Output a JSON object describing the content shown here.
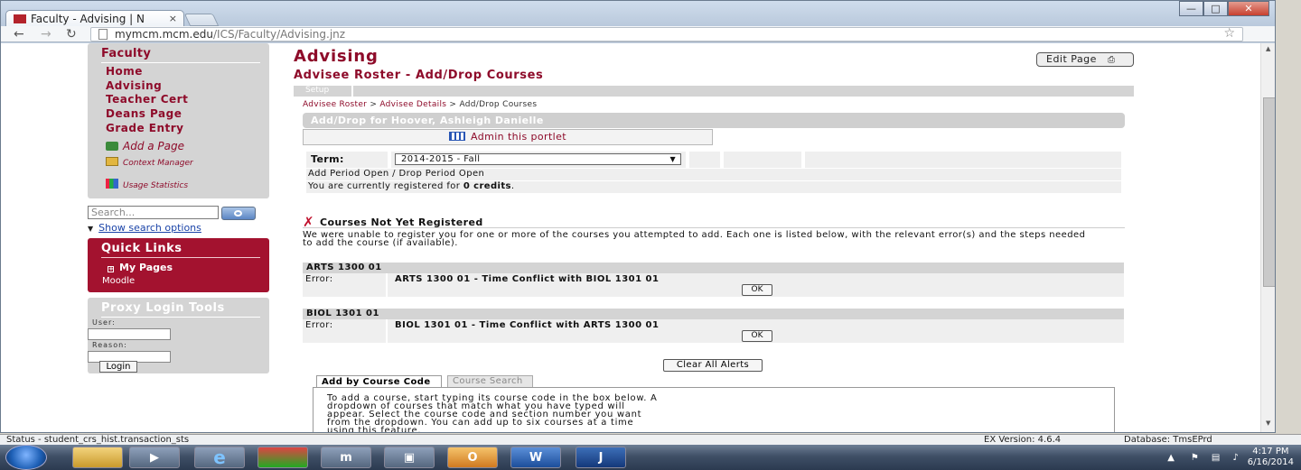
{
  "browser": {
    "tab_title": "Faculty - Advising | N",
    "tab_close": "×",
    "url_host": "mymcm.mcm.edu",
    "url_path": "/ICS/Faculty/Advising.jnz"
  },
  "status": {
    "text": "Status - student_crs_hist.transaction_sts",
    "ex_version": "EX Version: 4.6.4",
    "database": "Database: TmsEPrd"
  },
  "taskbar": {
    "time": "4:17 PM",
    "date": "6/16/2014",
    "word_label": "W",
    "j_label": "J"
  },
  "sidebar": {
    "faculty_title": "Faculty",
    "items": [
      "Home",
      "Advising",
      "Teacher Cert",
      "Deans Page",
      "Grade Entry"
    ],
    "add_page": "Add a Page",
    "context_manager": "Context Manager",
    "usage_statistics": "Usage Statistics",
    "search_placeholder": "Search...",
    "show_search": "Show search options",
    "quick_links_title": "Quick Links",
    "my_pages": "My Pages",
    "moodle": "Moodle",
    "proxy_title": "Proxy Login Tools",
    "user_label": "User:",
    "reason_label": "Reason:",
    "login_button": "Login"
  },
  "main": {
    "title": "Advising",
    "edit_page": "Edit Page",
    "subtitle": "Advisee Roster - Add/Drop Courses",
    "setup": "Setup",
    "breadcrumb": [
      "Advisee Roster",
      "Advisee Details",
      "Add/Drop Courses"
    ],
    "breadcrumb_sep": ">",
    "adddrop_header": "Add/Drop for Hoover, Ashleigh Danielle",
    "admin_portlet": "Admin this portlet",
    "term_label": "Term:",
    "term_value": "2014-2015 - Fall",
    "period_status": "Add Period Open / Drop Period Open",
    "credits_prefix": "You are currently registered for",
    "credits_value": "0 credits",
    "credits_suffix": ".",
    "not_registered_title": "Courses Not Yet Registered",
    "not_registered_msg": "We were unable to register you for one or more of the courses you attempted to add. Each one is listed below, with the relevant error(s) and the steps needed to add the course (if available).",
    "errors": [
      {
        "course": "ARTS 1300 01",
        "label": "Error:",
        "message": "ARTS 1300 01 - Time Conflict with BIOL 1301 01",
        "ok": "OK"
      },
      {
        "course": "BIOL 1301 01",
        "label": "Error:",
        "message": "BIOL 1301 01 - Time Conflict with ARTS 1300 01",
        "ok": "OK"
      }
    ],
    "clear_all": "Clear All Alerts",
    "tab_add_by_code": "Add by Course Code",
    "tab_course_search": "Course Search",
    "add_instructions": "To add a course, start typing its course code in the box below. A dropdown of courses that match what you have typed will appear. Select the course code and section number you want from the dropdown. You can add up to six courses at a time using this feature."
  }
}
